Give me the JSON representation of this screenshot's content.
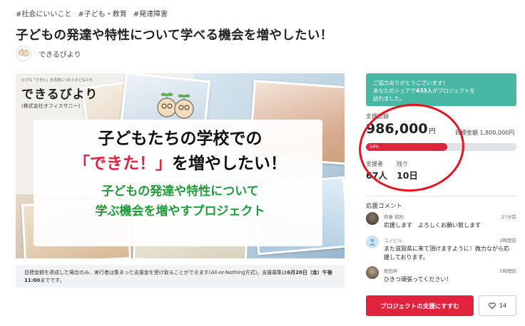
{
  "tags": [
    "#社会にいいこと",
    "#子ども・教育",
    "#発達障害"
  ],
  "title": "子どもの発達や特性について学べる機会を増やしたい！",
  "author": {
    "name": "できるびより",
    "avatar_icon": "avatar-couple-icon"
  },
  "hero": {
    "logo_tagline": "小さな「できた」を丹念につむぐ子どもたち",
    "logo_main": "できるびより",
    "logo_sub": "(株式会社オフィスサニー)",
    "line1": "子どもたちの学校での",
    "line2_red": "「できた！」",
    "line2_rest": "を増やしたい！",
    "line3": "子どもの発達や特性について",
    "line4": "学ぶ機会を増やすプロジェクト"
  },
  "note": {
    "text_before": "目標金額を達成した場合のみ、実行者は集まった支援金を受け取ることができます(All-or-Nothing方式)。支援募集は",
    "bold": "6月20日（金）午後11:00",
    "text_after": "までです。"
  },
  "share": {
    "line1": "ご協力ありがとうございます！",
    "line2_pre": "あなたのシェアで",
    "line2_bold": "433人",
    "line2_post": "がプロジェクトを",
    "line3": "訪れました。"
  },
  "funding": {
    "total_label": "支援総額",
    "amount": "986,000",
    "currency": "円",
    "target": "目標金額 1,800,000円",
    "percent_label": "54%",
    "percent": 54,
    "supporters_label": "支援者",
    "supporters": "67人",
    "remaining_label": "残り",
    "remaining": "10日"
  },
  "comments": {
    "title": "応援コメント",
    "items": [
      {
        "name": "斉藤 和則",
        "time": "27分前",
        "text": "応援します　よろしくお願い致します"
      },
      {
        "name": "コノビル",
        "time": "3時間前",
        "text": "また滋賀県に来て頂けますように！微力ながら応援しております。"
      },
      {
        "name": "飯田昇",
        "time": "5時間前",
        "text": "ひきつ頑張ってください！"
      }
    ]
  },
  "actions": {
    "support_button": "プロジェクトの支援にすすむ",
    "like_count": "14"
  },
  "colors": {
    "accent": "#e2233d",
    "share_bg": "#48b8a4",
    "annotation": "#e5131f",
    "green_text": "#1e9d3a"
  }
}
